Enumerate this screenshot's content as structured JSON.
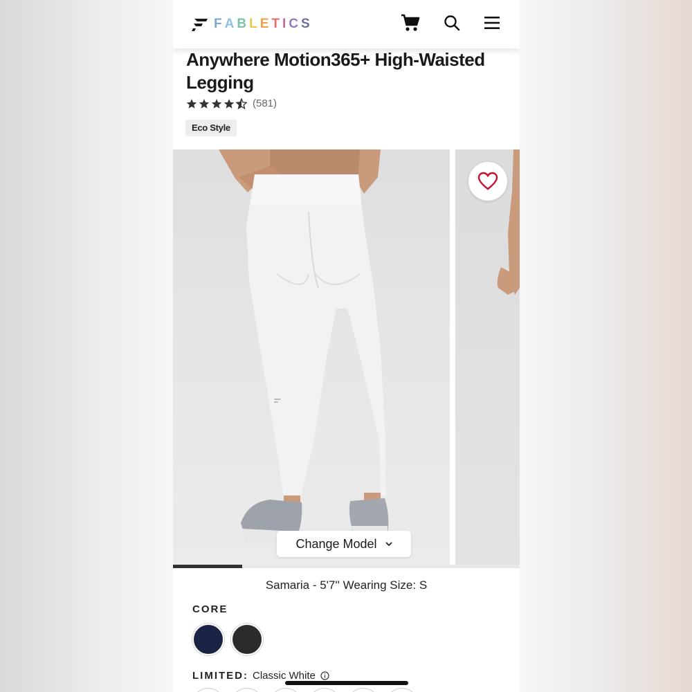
{
  "header": {
    "brand_letters": [
      {
        "ch": "F",
        "color": "#7aa6d4"
      },
      {
        "ch": "A",
        "color": "#8fbfe3"
      },
      {
        "ch": "B",
        "color": "#7cc2a8"
      },
      {
        "ch": "L",
        "color": "#e7c94a"
      },
      {
        "ch": "E",
        "color": "#f0a044"
      },
      {
        "ch": "T",
        "color": "#e56d6a"
      },
      {
        "ch": "I",
        "color": "#c9669a"
      },
      {
        "ch": "C",
        "color": "#9a76c6"
      },
      {
        "ch": "S",
        "color": "#6e6e9e"
      }
    ],
    "icons": [
      "cart-icon",
      "search-icon",
      "menu-icon"
    ]
  },
  "product": {
    "title": "Anywhere Motion365+ High-Waisted Legging",
    "rating": 4.5,
    "review_count": "(581)",
    "tag": "Eco Style"
  },
  "gallery": {
    "change_model_label": "Change Model",
    "slide_progress": 0.2
  },
  "model_info": "Samaria - 5'7'' Wearing Size: S",
  "colors": {
    "core_label": "CORE",
    "core_swatches": [
      {
        "name": "navy",
        "hex": "#1b2444"
      },
      {
        "name": "black",
        "hex": "#2b2b2b"
      }
    ],
    "limited_label": "LIMITED:",
    "limited_value": "Classic White"
  },
  "theme": {
    "accent": "#c8102e",
    "text": "#1a1a1a"
  }
}
